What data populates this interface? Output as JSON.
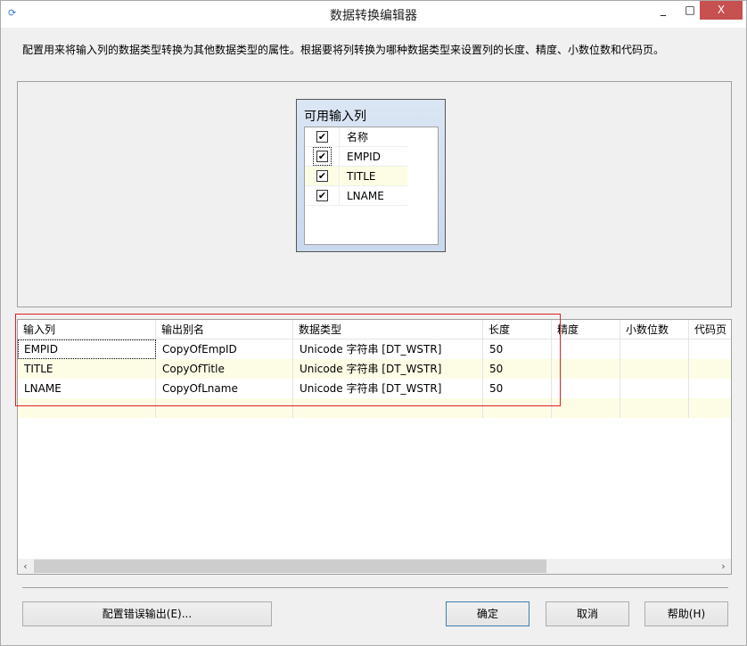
{
  "window": {
    "title": "数据转换编辑器",
    "minimize": "_",
    "maximize": "□",
    "close": "X"
  },
  "description": "配置用来将输入列的数据类型转换为其他数据类型的属性。根据要将列转换为哪种数据类型来设置列的长度、精度、小数位数和代码页。",
  "available_columns": {
    "title": "可用输入列",
    "header": {
      "checked": true,
      "label": "名称"
    },
    "items": [
      {
        "checked": true,
        "label": "EMPID"
      },
      {
        "checked": true,
        "label": "TITLE"
      },
      {
        "checked": true,
        "label": "LNAME"
      }
    ]
  },
  "grid": {
    "columns": [
      "输入列",
      "输出别名",
      "数据类型",
      "长度",
      "精度",
      "小数位数",
      "代码页"
    ],
    "rows": [
      [
        "EMPID",
        "CopyOfEmpID",
        "Unicode 字符串 [DT_WSTR]",
        "50",
        "",
        "",
        ""
      ],
      [
        "TITLE",
        "CopyOfTitle",
        "Unicode 字符串 [DT_WSTR]",
        "50",
        "",
        "",
        ""
      ],
      [
        "LNAME",
        "CopyOfLname",
        "Unicode 字符串 [DT_WSTR]",
        "50",
        "",
        "",
        ""
      ]
    ]
  },
  "buttons": {
    "error_output": "配置错误输出(E)...",
    "ok": "确定",
    "cancel": "取消",
    "help": "帮助(H)"
  }
}
